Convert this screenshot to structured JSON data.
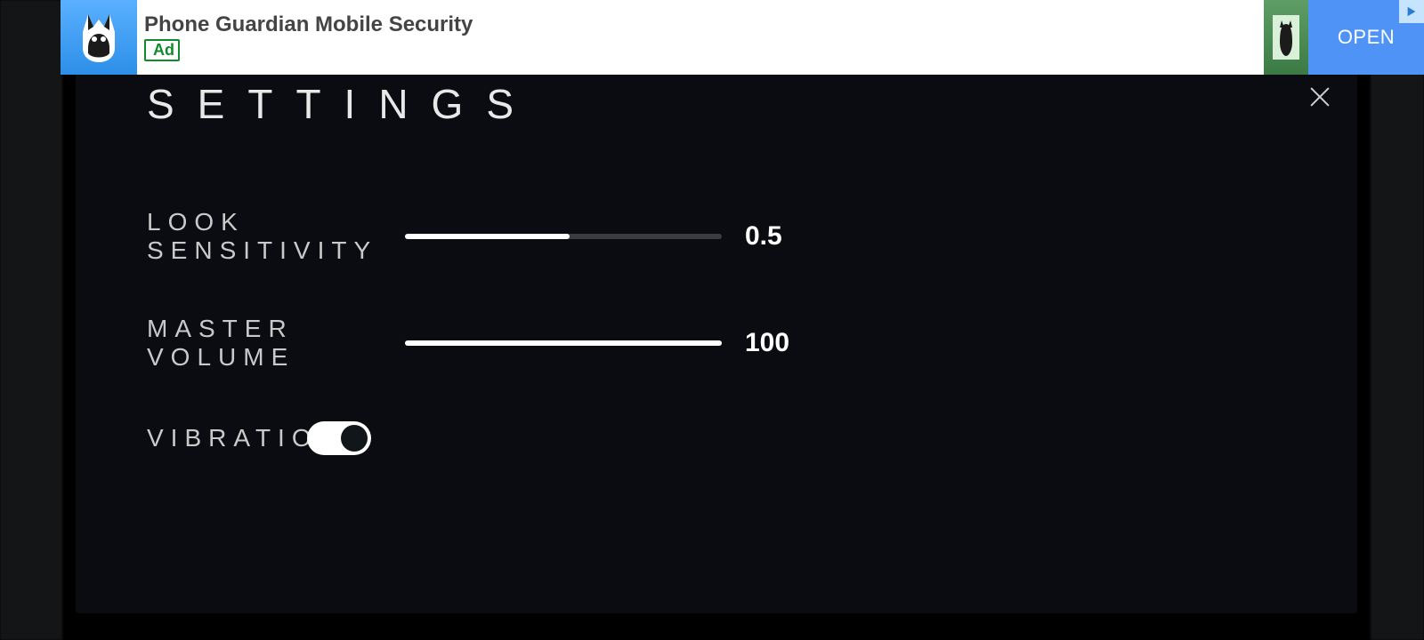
{
  "ad": {
    "title": "Phone Guardian Mobile Security",
    "badge": "Ad",
    "open_label": "OPEN"
  },
  "panel": {
    "title": "SETTINGS",
    "rows": {
      "look_sensitivity": {
        "label": "LOOK SENSITIVITY",
        "value": "0.5",
        "fill_percent": 52
      },
      "master_volume": {
        "label": "MASTER VOLUME",
        "value": "100",
        "fill_percent": 100
      },
      "vibration": {
        "label": "VIBRATION",
        "state": "on"
      }
    }
  }
}
